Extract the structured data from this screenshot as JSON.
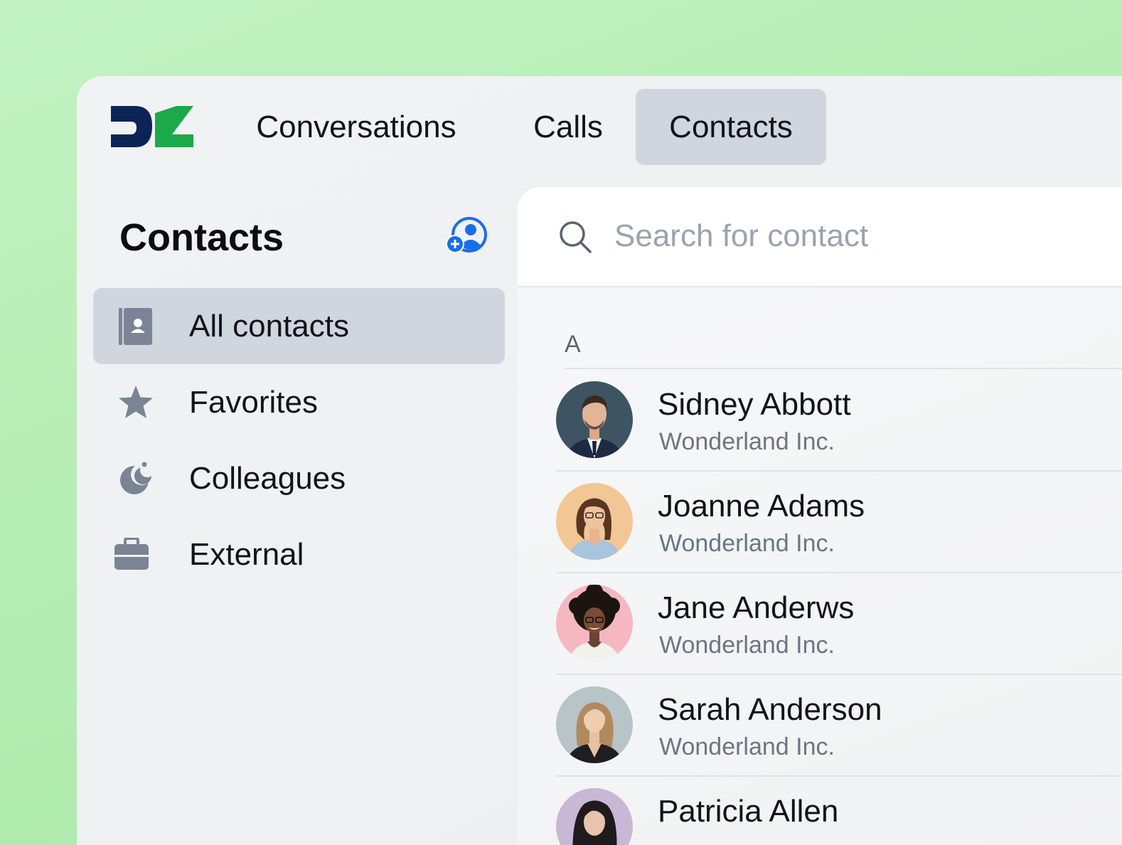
{
  "nav": {
    "logo": "dialpad-logo",
    "tabs": [
      {
        "label": "Conversations",
        "active": false
      },
      {
        "label": "Calls",
        "active": false
      },
      {
        "label": "Contacts",
        "active": true
      }
    ]
  },
  "sidebar": {
    "title": "Contacts",
    "add_icon": "add-contact-icon",
    "items": [
      {
        "label": "All contacts",
        "icon": "contact-book-icon",
        "active": true
      },
      {
        "label": "Favorites",
        "icon": "star-icon",
        "active": false
      },
      {
        "label": "Colleagues",
        "icon": "colleagues-icon",
        "active": false
      },
      {
        "label": "External",
        "icon": "briefcase-icon",
        "active": false
      }
    ]
  },
  "search": {
    "placeholder": "Search for contact",
    "value": ""
  },
  "contacts": {
    "section": "A",
    "list": [
      {
        "name": "Sidney Abbott",
        "company": "Wonderland Inc.",
        "avatar_bg": "#3e5463"
      },
      {
        "name": "Joanne Adams",
        "company": "Wonderland Inc.",
        "avatar_bg": "#f2c795"
      },
      {
        "name": "Jane Anderws",
        "company": "Wonderland Inc.",
        "avatar_bg": "#f5b8c0"
      },
      {
        "name": "Sarah Anderson",
        "company": "Wonderland Inc.",
        "avatar_bg": "#b7c4c8"
      },
      {
        "name": "Patricia Allen",
        "company": "",
        "avatar_bg": "#c9b7d6"
      }
    ]
  },
  "colors": {
    "accent": "#1a6dea",
    "logo_navy": "#0c2455",
    "logo_green": "#1ca94a",
    "active_bg": "#d0d6de",
    "icon_gray": "#7a8494"
  }
}
